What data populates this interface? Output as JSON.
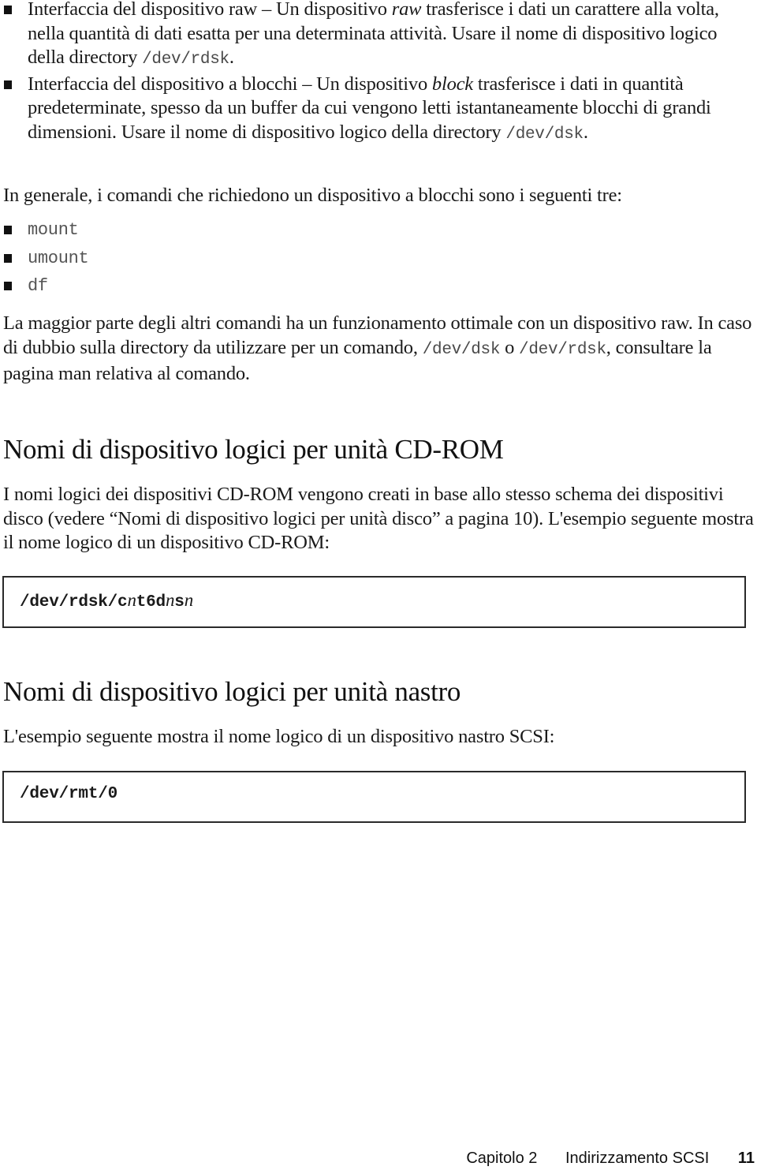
{
  "device_interfaces": [
    {
      "runs": [
        {
          "t": "Interfaccia del dispositivo raw – Un dispositivo "
        },
        {
          "t": "raw",
          "style": "italic"
        },
        {
          "t": " trasferisce i dati un carattere alla volta, nella quantità di dati esatta per una determinata attività. Usare il nome di dispositivo logico della directory "
        },
        {
          "t": "/dev/rdsk",
          "style": "mono"
        },
        {
          "t": "."
        }
      ]
    },
    {
      "runs": [
        {
          "t": "Interfaccia del dispositivo a blocchi – Un dispositivo "
        },
        {
          "t": "block",
          "style": "italic"
        },
        {
          "t": " trasferisce i dati in quantità predeterminate, spesso da un buffer da cui vengono letti istantaneamente blocchi di grandi dimensioni. Usare il nome di dispositivo logico della directory "
        },
        {
          "t": "/dev/dsk",
          "style": "mono"
        },
        {
          "t": "."
        }
      ]
    }
  ],
  "block_commands_intro": "In generale, i comandi che richiedono un dispositivo a blocchi sono i seguenti tre:",
  "block_commands": [
    "mount",
    "umount",
    "df"
  ],
  "raw_note": {
    "runs": [
      {
        "t": "La maggior parte degli altri comandi ha un funzionamento ottimale con un dispositivo raw. In caso di dubbio sulla directory da utilizzare per un comando, "
      },
      {
        "t": "/dev/dsk",
        "style": "mono"
      },
      {
        "t": " o "
      },
      {
        "t": "/dev/rdsk",
        "style": "mono"
      },
      {
        "t": ", consultare la pagina man relativa al comando."
      }
    ]
  },
  "sections": {
    "cdrom": {
      "heading": "Nomi di dispositivo logici per unità CD-ROM",
      "paragraph": "I nomi logici dei dispositivi CD-ROM vengono creati in base allo stesso schema dei dispositivi disco (vedere “Nomi di dispositivo logici per unità disco” a pagina 10). L'esempio seguente mostra il nome logico di un dispositivo CD-ROM:",
      "code_example": [
        {
          "t": "/dev/rdsk/c"
        },
        {
          "t": "n",
          "style": "var"
        },
        {
          "t": "t6d"
        },
        {
          "t": "n",
          "style": "var"
        },
        {
          "t": "s"
        },
        {
          "t": "n",
          "style": "var"
        }
      ]
    },
    "tape": {
      "heading": "Nomi di dispositivo logici per unità nastro",
      "paragraph": "L'esempio seguente mostra il nome logico di un dispositivo nastro SCSI:",
      "code_example": [
        {
          "t": "/dev/rmt/0"
        }
      ]
    }
  },
  "footer": {
    "chapter": "Capitolo 2",
    "chapter_title": "Indirizzamento SCSI",
    "page_number": "11"
  }
}
